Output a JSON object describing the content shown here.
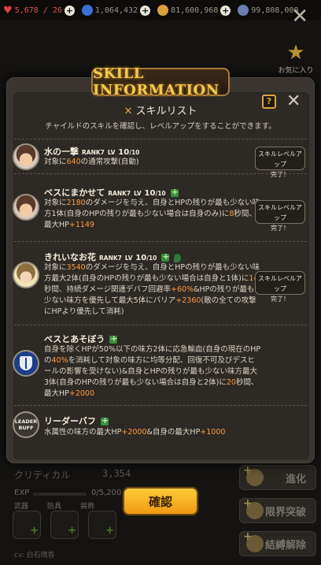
{
  "topbar": {
    "hearts": "5,678 / 26",
    "coins": "1,064,432",
    "gold": "81,600,968",
    "gems": "99,808,000"
  },
  "favorite": {
    "label": "お気に入り"
  },
  "dialog": {
    "header": "SKILL INFORMATION",
    "list_title": "スキルリスト",
    "subtitle": "チャイルドのスキルを確認し、レベルアップをすることができます。",
    "help": "?",
    "confirm": "確認"
  },
  "skills": [
    {
      "name": "水の一撃",
      "rank": "RANK7",
      "lv_prefix": "LV",
      "lv": "10",
      "lv_max": "/10",
      "desc": [
        {
          "t": "対象に"
        },
        {
          "t": "640",
          "c": "num"
        },
        {
          "t": "の通常攻撃(自動)"
        }
      ],
      "badge": [
        "スキルレベルアップ",
        "完了！"
      ]
    },
    {
      "name": "ベスにまかせて",
      "rank": "RANK7",
      "lv_prefix": "LV",
      "lv": "10",
      "lv_max": "/10",
      "desc": [
        {
          "t": "対象に"
        },
        {
          "t": "2180",
          "c": "num"
        },
        {
          "t": "のダメージを与え、自身とHPの残りが最も少ない味方1体(自身のHPの残りが最も少ない場合は自身のみ)に"
        },
        {
          "t": "8",
          "c": "num"
        },
        {
          "t": "秒間、最大HP"
        },
        {
          "t": "+1149",
          "c": "num"
        }
      ],
      "badge": [
        "スキルレベルアップ",
        "完了！"
      ]
    },
    {
      "name": "きれいなお花",
      "rank": "RANK7",
      "lv_prefix": "LV",
      "lv": "10",
      "lv_max": "/10",
      "desc": [
        {
          "t": "対象に"
        },
        {
          "t": "3540",
          "c": "num"
        },
        {
          "t": "のダメージを与え、自身とHPの残りが最も少ない味方最大2体(自身のHPの残りが最も少ない場合は自身と1体)に"
        },
        {
          "t": "14",
          "c": "num"
        },
        {
          "t": "秒間、持続ダメージ関連デバフ回避率"
        },
        {
          "t": "+60%",
          "c": "num"
        },
        {
          "t": "&HPの残りが最も少ない味方を優先して最大5体にバリア"
        },
        {
          "t": "+2360",
          "c": "num"
        },
        {
          "t": "(敵の全ての攻撃にHPより優先して消耗)"
        }
      ],
      "badge": [
        "スキルレベルアップ",
        "完了！"
      ]
    },
    {
      "name": "ベスとあそぼう",
      "desc": [
        {
          "t": "自身を除くHPが50%以下の味方2体に応急輸血(自身の現在のHPの"
        },
        {
          "t": "40%",
          "c": "num"
        },
        {
          "t": "を消耗して対象の味方に均等分配、回復不可及びデスヒールの影響を受けない)&自身とHPの残りが最も少ない味方最大3体(自身のHPの残りが最も少ない場合は自身と2体)に"
        },
        {
          "t": "20",
          "c": "num"
        },
        {
          "t": "秒間、最大HP"
        },
        {
          "t": "+2000",
          "c": "num"
        }
      ]
    },
    {
      "name": "リーダーバフ",
      "avatar_text": [
        "LEADER",
        "BUFF"
      ],
      "desc": [
        {
          "t": "水属性の味方の最大HP"
        },
        {
          "t": "+2000",
          "c": "num"
        },
        {
          "t": "&自身の最大HP"
        },
        {
          "t": "+1000",
          "c": "num"
        }
      ]
    }
  ],
  "background": {
    "critical_label": "クリティカル",
    "critical_value": "3,354",
    "exp_label": "EXP",
    "exp_value": "0/5,200",
    "slot_labels": [
      "武器",
      "防具",
      "装飾"
    ],
    "cv": "cv: 白石晴香",
    "side_buttons": [
      "進化",
      "限界突破",
      "結縛解除"
    ]
  }
}
